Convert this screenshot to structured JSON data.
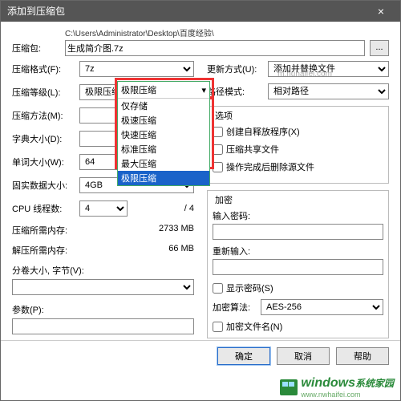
{
  "title": "添加到压缩包",
  "path_display": "C:\\Users\\Administrator\\Desktop\\百度经验\\",
  "archive": {
    "label": "压缩包:",
    "value": "生成简介图.7z",
    "browse": "..."
  },
  "left": {
    "format": {
      "label": "压缩格式(F):",
      "value": "7z"
    },
    "level": {
      "label": "压缩等级(L):",
      "value": "极限压缩",
      "options": [
        "仅存储",
        "极速压缩",
        "快速压缩",
        "标准压缩",
        "最大压缩",
        "极限压缩"
      ]
    },
    "method": {
      "label": "压缩方法(M):",
      "value": ""
    },
    "dict": {
      "label": "字典大小(D):",
      "value": ""
    },
    "word": {
      "label": "单词大小(W):",
      "value": "64"
    },
    "solid": {
      "label": "固实数据大小:",
      "value": "4GB"
    },
    "threads": {
      "label": "CPU 线程数:",
      "value": "4",
      "total": "/ 4"
    },
    "mem_c": {
      "label": "压缩所需内存:",
      "value": "2733 MB"
    },
    "mem_d": {
      "label": "解压所需内存:",
      "value": "66 MB"
    },
    "split": {
      "label": "分卷大小, 字节(V):"
    },
    "params": {
      "label": "参数(P):"
    }
  },
  "right": {
    "update": {
      "label": "更新方式(U):",
      "value": "添加并替换文件"
    },
    "pathmode": {
      "label": "路径模式:",
      "value": "相对路径"
    },
    "options_title": "选项",
    "opt_sfx": "创建自释放程序(X)",
    "opt_shared": "压缩共享文件",
    "opt_delete": "操作完成后删除源文件",
    "enc_title": "加密",
    "pw1": "输入密码:",
    "pw2": "重新输入:",
    "showpw": "显示密码(S)",
    "alg": {
      "label": "加密算法:",
      "value": "AES-256"
    },
    "encnames": "加密文件名(N)"
  },
  "buttons": {
    "ok": "确定",
    "cancel": "取消",
    "help": "帮助"
  },
  "watermark": {
    "text": "windows",
    "sub": "系统家园",
    "url": "www.nwhaifei.com"
  },
  "faint_url": "m.nuhaifei.com"
}
